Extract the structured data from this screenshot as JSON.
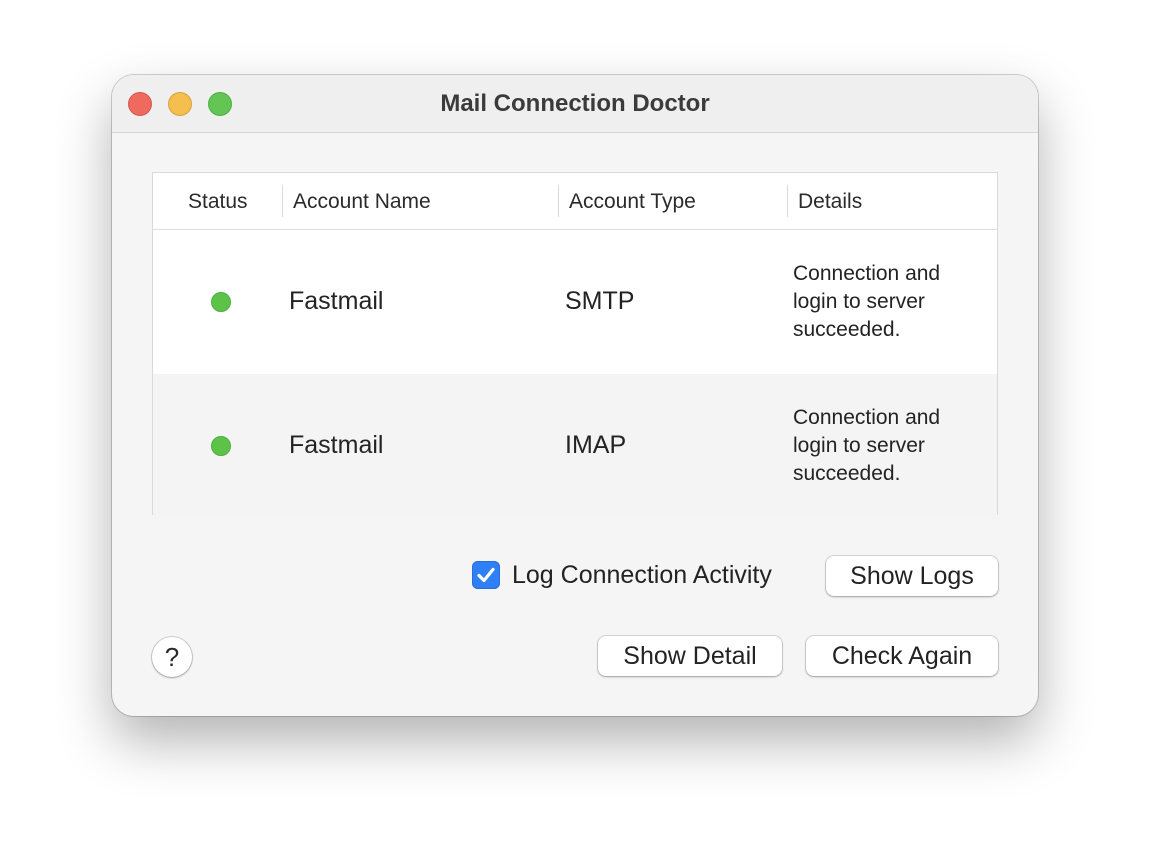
{
  "window": {
    "title": "Mail Connection Doctor"
  },
  "table": {
    "columns": [
      "Status",
      "Account Name",
      "Account Type",
      "Details"
    ],
    "rows": [
      {
        "status": "connected",
        "account_name": "Fastmail",
        "account_type": "SMTP",
        "details_lines": [
          "Connection and",
          "login to server",
          "succeeded."
        ]
      },
      {
        "status": "connected",
        "account_name": "Fastmail",
        "account_type": "IMAP",
        "details_lines": [
          "Connection and",
          "login to server",
          "succeeded."
        ]
      }
    ]
  },
  "log_activity": {
    "label": "Log Connection Activity",
    "checked": true
  },
  "buttons": {
    "show_logs": "Show Logs",
    "show_detail": "Show Detail",
    "check_again": "Check Again",
    "help": "?"
  },
  "colors": {
    "status_green": "#5cc348",
    "checkbox_blue": "#2f7ff6",
    "traffic_close": "#ee6a5e",
    "traffic_minimize": "#f5bf4f",
    "traffic_zoom": "#62c554"
  },
  "icons": {
    "close": "close-traffic-light-icon",
    "minimize": "minimize-traffic-light-icon",
    "zoom": "zoom-traffic-light-icon",
    "status": "status-dot-icon",
    "checkbox": "checkmark-icon",
    "help": "help-icon"
  }
}
